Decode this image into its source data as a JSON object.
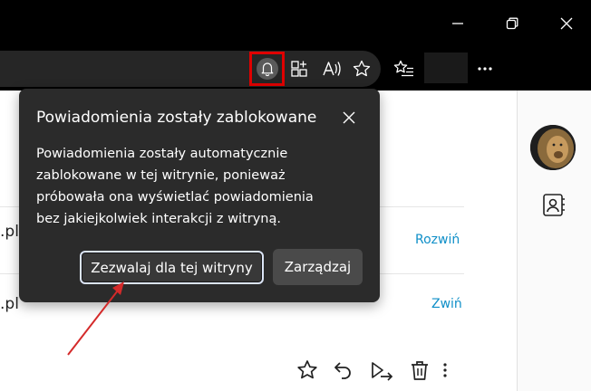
{
  "popup": {
    "title": "Powiadomienia zostały zablokowane",
    "body_lines": [
      "Powiadomienia zostały automatycznie",
      "zablokowane w tej witrynie, ponieważ",
      "próbowała ona wyświetlać powiadomienia",
      "bez jakiejkolwiek interakcji z witryną."
    ],
    "allow_button": "Zezwalaj dla tej witryny",
    "manage_button": "Zarządzaj"
  },
  "page": {
    "rows": [
      {
        "text": ".pl",
        "action": "Rozwiń"
      },
      {
        "text": ".pl",
        "action": "Zwiń"
      }
    ]
  },
  "colors": {
    "highlight_box": "#e00000",
    "arrow": "#d42a2a",
    "link": "#0f8fc8",
    "popup_bg": "#2b2b2b"
  },
  "icons": {
    "toolbar": [
      "bell-icon",
      "extensions-icon",
      "read-aloud-icon",
      "favorite-star-icon",
      "favorites-list-icon",
      "more-icon"
    ],
    "actions": [
      "star-icon",
      "reply-icon",
      "forward-icon",
      "delete-icon",
      "more-vertical-icon"
    ]
  }
}
